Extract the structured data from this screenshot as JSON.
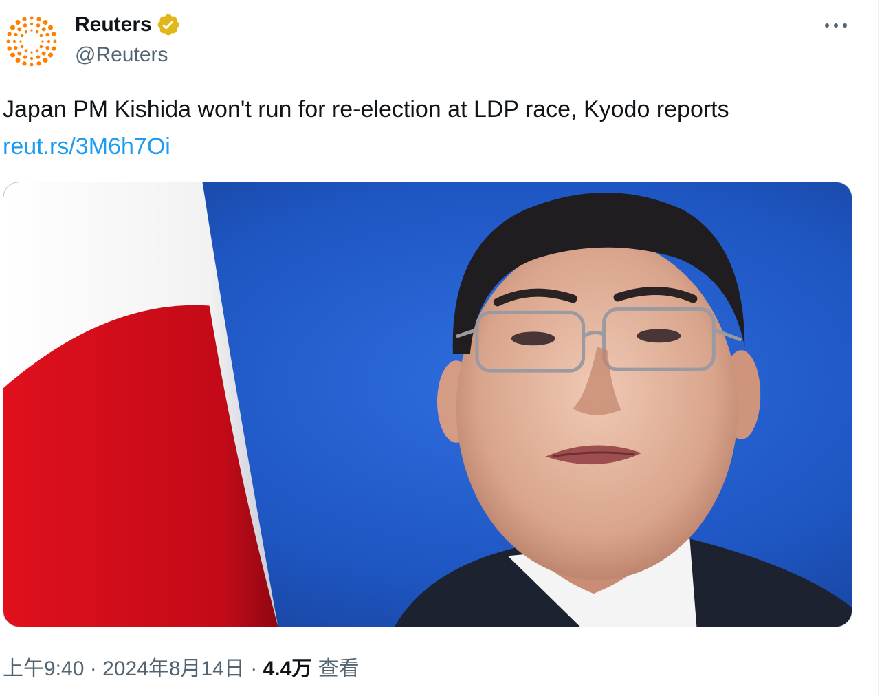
{
  "author": {
    "display_name": "Reuters",
    "handle": "@Reuters",
    "avatar_icon": "reuters-dots-logo",
    "verified_icon": "verified-badge-icon",
    "brand_color": "#ff8000",
    "verified_color": "#e2b719"
  },
  "actions": {
    "more_icon": "more-horizontal-icon"
  },
  "tweet": {
    "text": "Japan PM Kishida won't run for re-election at LDP race, Kyodo reports",
    "link": "reut.rs/3M6h7Oi"
  },
  "media": {
    "subject": "photo-kishida-with-japanese-flag"
  },
  "meta": {
    "time": "上午9:40",
    "separator": "·",
    "date": "2024年8月14日",
    "views_count": "4.4万",
    "views_label": "查看"
  },
  "colors": {
    "link": "#1d9bf0",
    "text": "#0f1419",
    "secondary": "#536471"
  }
}
